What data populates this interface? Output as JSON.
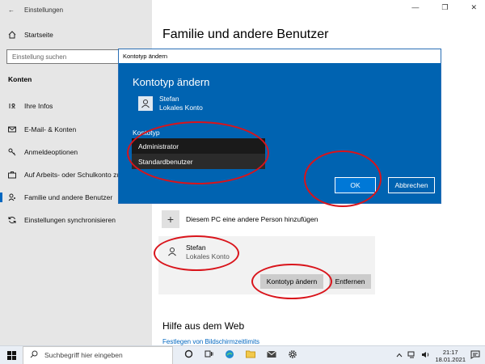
{
  "window": {
    "title": "Einstellungen",
    "back_glyph": "←",
    "minimize": "—",
    "maximize": "❐",
    "close": "✕"
  },
  "sidebar": {
    "home": {
      "label": "Startseite",
      "icon": "home-icon"
    },
    "search_placeholder": "Einstellung suchen",
    "section": "Konten",
    "items": [
      {
        "label": "Ihre Infos",
        "icon": "person-card-icon"
      },
      {
        "label": "E-Mail- & Konten",
        "icon": "mail-icon"
      },
      {
        "label": "Anmeldeoptionen",
        "icon": "key-icon"
      },
      {
        "label": "Auf Arbeits- oder Schulkonto zugreifen",
        "icon": "briefcase-icon"
      },
      {
        "label": "Familie und andere Benutzer",
        "icon": "family-icon"
      },
      {
        "label": "Einstellungen synchronisieren",
        "icon": "sync-icon"
      }
    ]
  },
  "main": {
    "title": "Familie und andere Benutzer",
    "add_person": "Diesem PC eine andere Person hinzufügen",
    "user": {
      "name": "Stefan",
      "type": "Lokales Konto"
    },
    "change_type_button": "Kontotyp ändern",
    "remove_button": "Entfernen",
    "help_title": "Hilfe aus dem Web",
    "help_link": "Festlegen von Bildschirmzeitlimits"
  },
  "dialog": {
    "titlebar": "Kontotyp ändern",
    "heading": "Kontotyp ändern",
    "user_name": "Stefan",
    "user_type": "Lokales Konto",
    "kontotyp_label": "Kontotyp",
    "options": [
      "Administrator",
      "Standardbenutzer"
    ],
    "selected": "Administrator",
    "ok": "OK",
    "cancel": "Abbrechen"
  },
  "taskbar": {
    "search_placeholder": "Suchbegriff hier eingeben",
    "time": "21:17",
    "date": "18.01.2021"
  },
  "colors": {
    "accent": "#0063b1",
    "annotation": "#d9141b"
  }
}
